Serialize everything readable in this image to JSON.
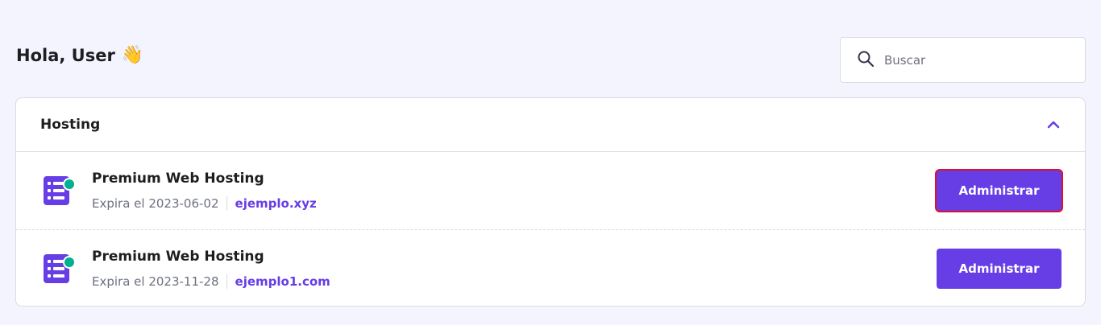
{
  "header": {
    "greeting": "Hola, User",
    "greeting_emoji": "👋"
  },
  "search": {
    "placeholder": "Buscar",
    "value": "",
    "icon": "search-icon"
  },
  "section": {
    "title": "Hosting",
    "collapse_icon": "chevron-up-icon",
    "expanded": true
  },
  "services": [
    {
      "name": "Premium Web Hosting",
      "expiry": "Expira el 2023-06-02",
      "domain": "ejemplo.xyz",
      "button_label": "Administrar",
      "icon": "hosting-server-icon",
      "status": "active"
    },
    {
      "name": "Premium Web Hosting",
      "expiry": "Expira el 2023-11-28",
      "domain": "ejemplo1.com",
      "button_label": "Administrar",
      "icon": "hosting-server-icon",
      "status": "active"
    }
  ],
  "colors": {
    "accent": "#673de6",
    "status_active": "#00b090",
    "background": "#f4f4ff",
    "highlight_outline": "#e0102a"
  }
}
